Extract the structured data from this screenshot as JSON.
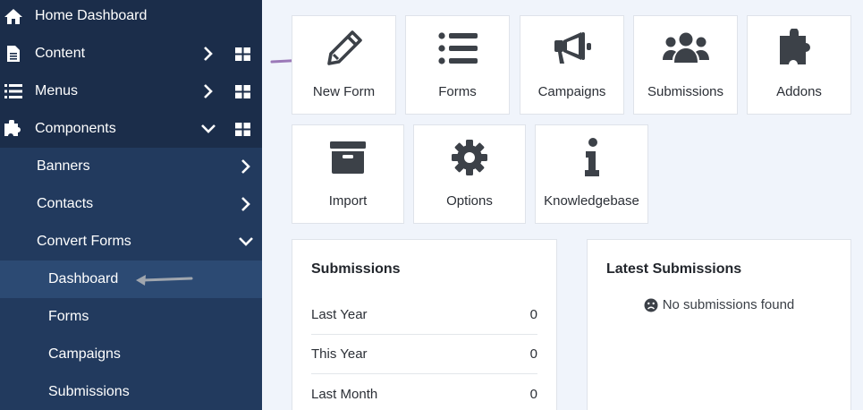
{
  "sidebar": {
    "items": [
      {
        "label": "Home Dashboard"
      },
      {
        "label": "Content"
      },
      {
        "label": "Menus"
      },
      {
        "label": "Components"
      },
      {
        "label": "Banners"
      },
      {
        "label": "Contacts"
      },
      {
        "label": "Convert Forms"
      },
      {
        "label": "Dashboard"
      },
      {
        "label": "Forms"
      },
      {
        "label": "Campaigns"
      },
      {
        "label": "Submissions"
      }
    ]
  },
  "tiles": [
    {
      "label": "New Form",
      "icon": "pencil-icon"
    },
    {
      "label": "Forms",
      "icon": "list-icon"
    },
    {
      "label": "Campaigns",
      "icon": "bullhorn-icon"
    },
    {
      "label": "Submissions",
      "icon": "users-icon"
    },
    {
      "label": "Addons",
      "icon": "puzzle-icon"
    },
    {
      "label": "Import",
      "icon": "archive-icon"
    },
    {
      "label": "Options",
      "icon": "gear-icon"
    },
    {
      "label": "Knowledgebase",
      "icon": "info-icon"
    }
  ],
  "submissions_panel": {
    "title": "Submissions",
    "rows": [
      {
        "label": "Last Year",
        "value": "0"
      },
      {
        "label": "This Year",
        "value": "0"
      },
      {
        "label": "Last Month",
        "value": "0"
      }
    ]
  },
  "latest_panel": {
    "title": "Latest Submissions",
    "empty_text": "No submissions found"
  },
  "colors": {
    "sidebar_bg": "#1b2d4a",
    "submenu_bg": "#223a5e",
    "active_bg": "#2c4a73",
    "icon_dark": "#3c4148",
    "arrow_purple": "#9b79b8",
    "arrow_gray": "#a0a6ae"
  }
}
